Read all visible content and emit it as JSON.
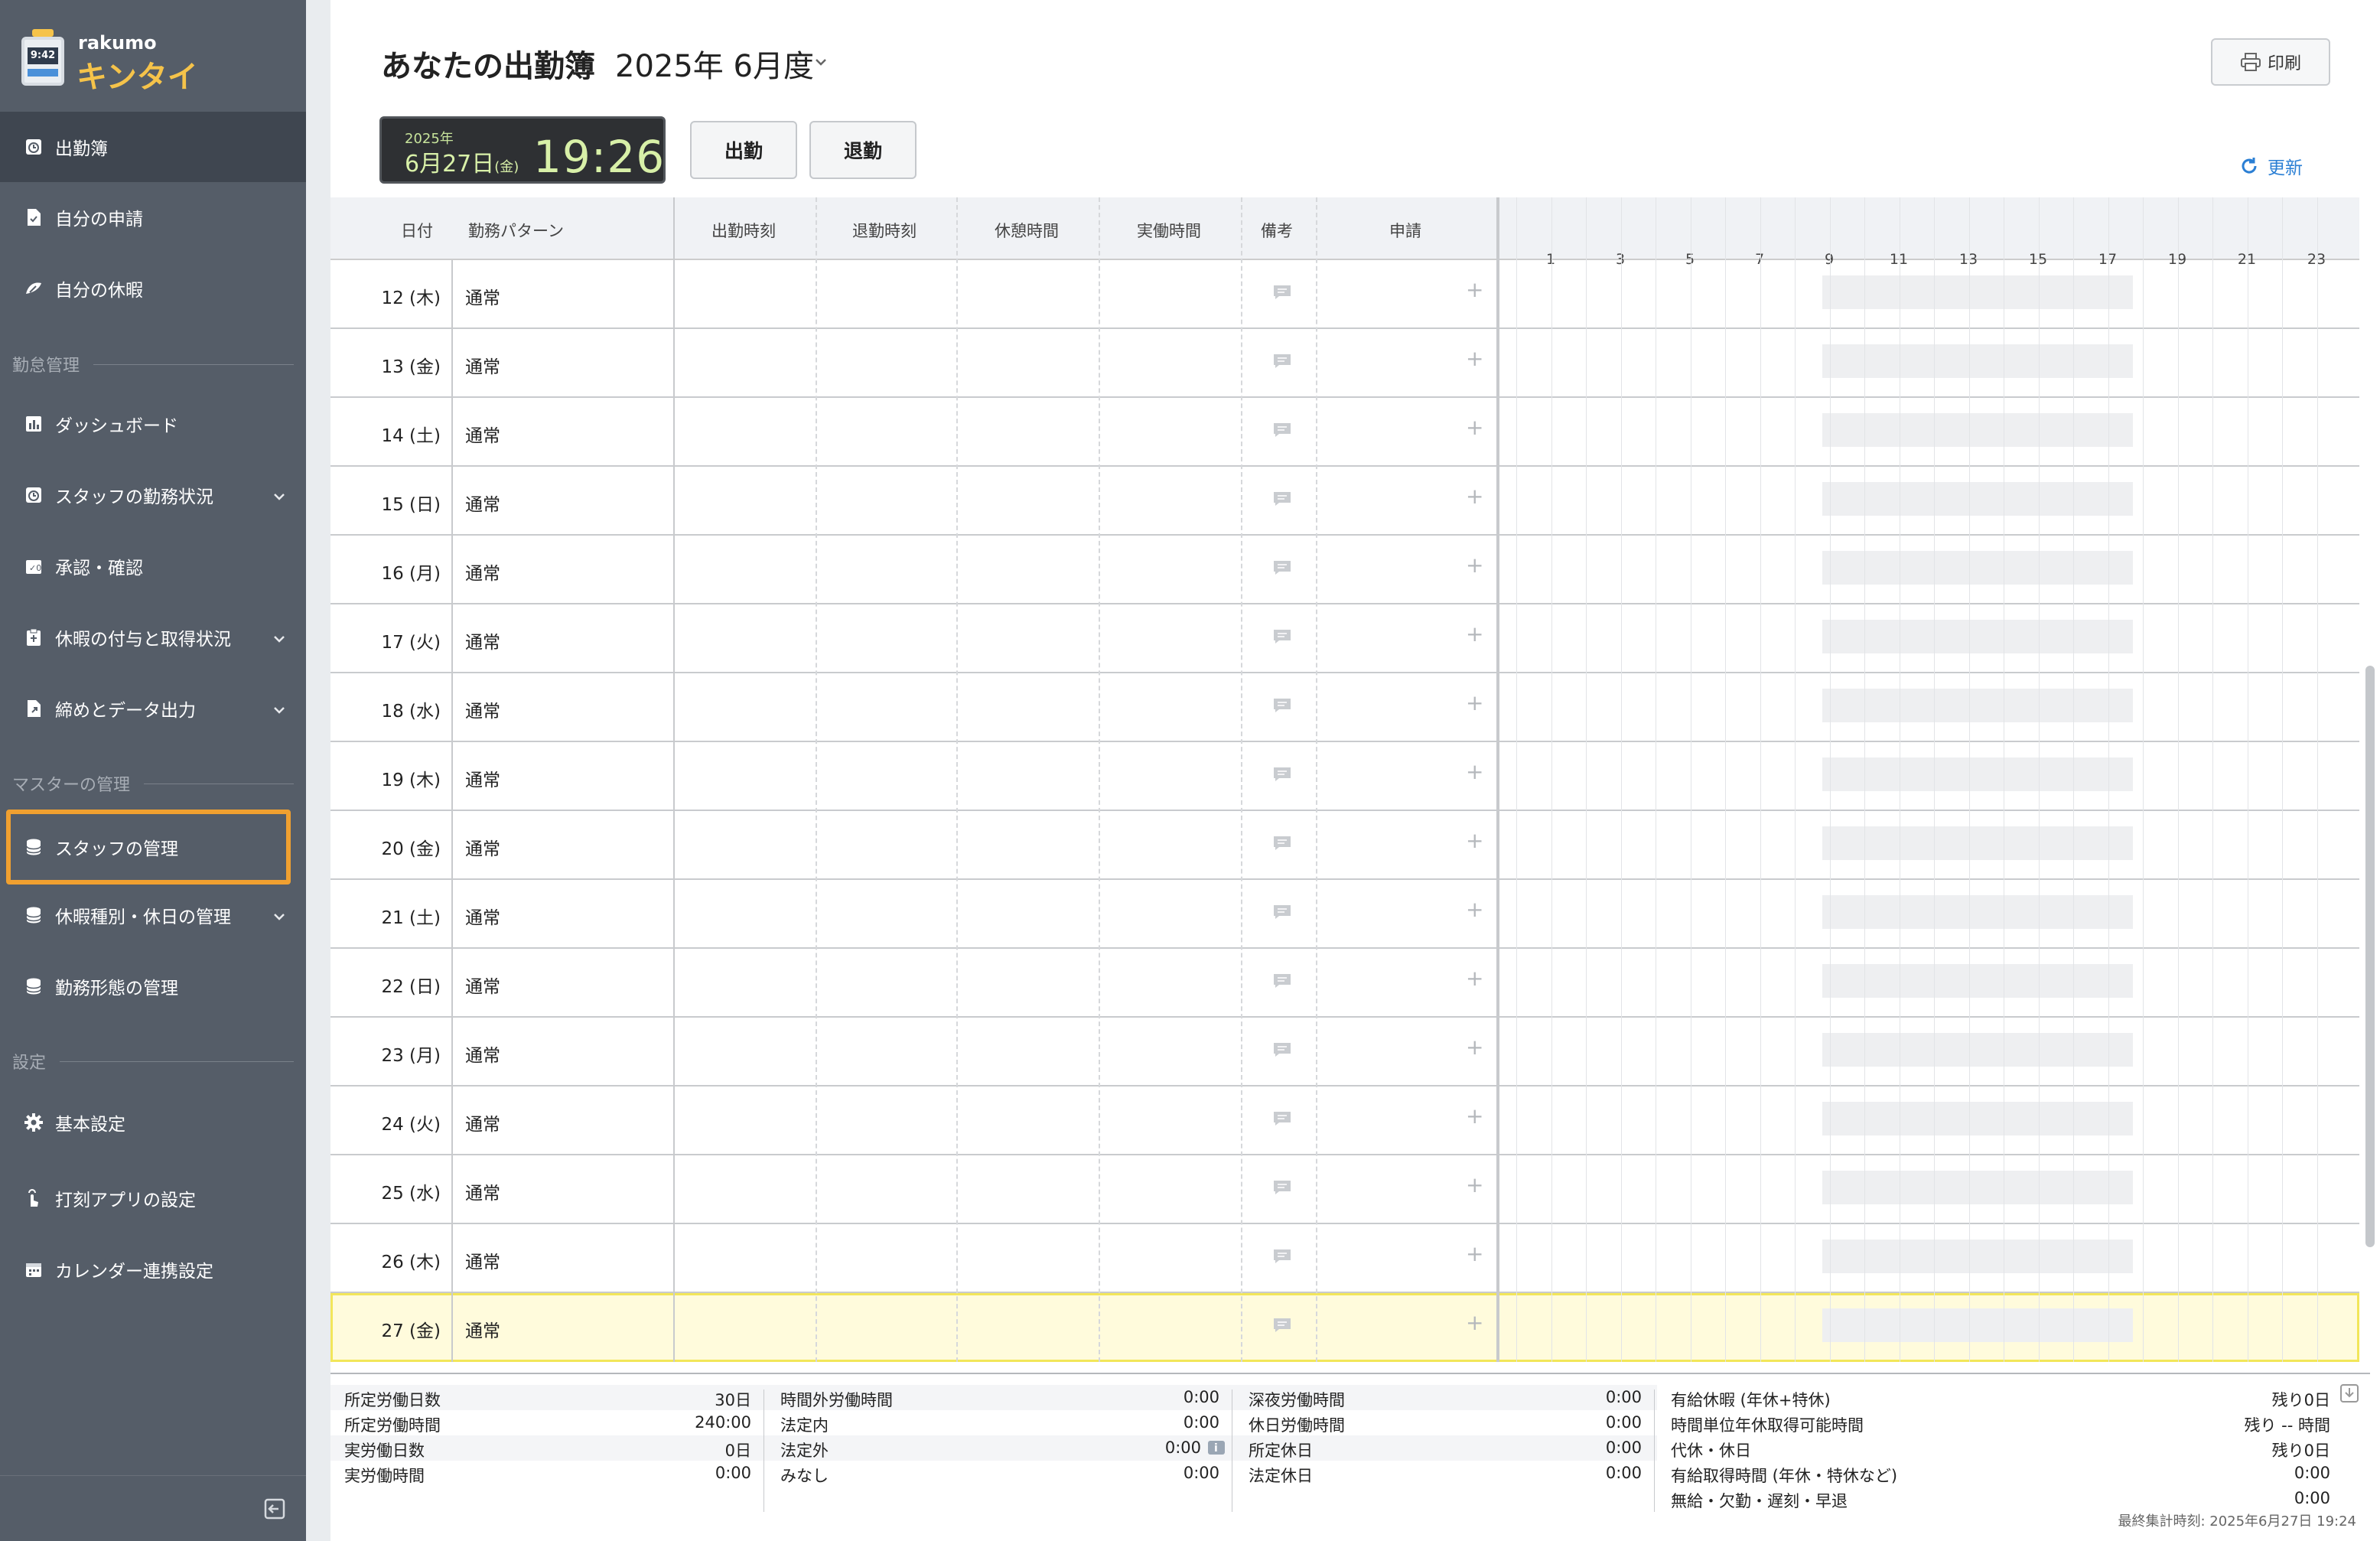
{
  "app": {
    "logo_text_top": "rakumo",
    "logo_text_bottom": "キンタイ",
    "logo_clock": "9:42"
  },
  "sidebar": {
    "items_top": [
      {
        "label": "出勤簿",
        "icon": "clock-icon",
        "active": true
      },
      {
        "label": "自分の申請",
        "icon": "document-icon"
      },
      {
        "label": "自分の休暇",
        "icon": "leave-icon"
      }
    ],
    "section_attendance": "勤怠管理",
    "items_attendance": [
      {
        "label": "ダッシュボード",
        "icon": "chart-icon"
      },
      {
        "label": "スタッフの勤務状況",
        "icon": "clock-icon",
        "expand": true
      },
      {
        "label": "承認・確認",
        "icon": "approve-icon"
      },
      {
        "label": "休暇の付与と取得状況",
        "icon": "clipboard-icon",
        "expand": true
      },
      {
        "label": "締めとデータ出力",
        "icon": "export-icon",
        "expand": true
      }
    ],
    "section_master": "マスターの管理",
    "items_master": [
      {
        "label": "スタッフの管理",
        "icon": "database-icon",
        "highlight": true
      },
      {
        "label": "休暇種別・休日の管理",
        "icon": "database-icon",
        "expand": true
      },
      {
        "label": "勤務形態の管理",
        "icon": "database-icon"
      }
    ],
    "section_settings": "設定",
    "items_settings": [
      {
        "label": "基本設定",
        "icon": "gear-icon"
      },
      {
        "label": "打刻アプリの設定",
        "icon": "tap-icon"
      },
      {
        "label": "カレンダー連携設定",
        "icon": "calendar-icon"
      }
    ]
  },
  "header": {
    "title": "あなたの出勤簿",
    "month": "2025年 6月度",
    "print_label": "印刷",
    "refresh_label": "更新"
  },
  "clock": {
    "year": "2025年",
    "date": "6月27日",
    "weekday": "(金)",
    "time": "19:26"
  },
  "buttons": {
    "clock_in": "出勤",
    "clock_out": "退勤"
  },
  "table": {
    "columns": [
      "日付",
      "勤務パターン",
      "出勤時刻",
      "退勤時刻",
      "休憩時間",
      "実働時間",
      "備考",
      "申請"
    ],
    "hours": [
      "1",
      "3",
      "5",
      "7",
      "9",
      "11",
      "13",
      "15",
      "17",
      "19",
      "21",
      "23"
    ],
    "rows": [
      {
        "date": "12 (木)",
        "pattern": "通常"
      },
      {
        "date": "13 (金)",
        "pattern": "通常"
      },
      {
        "date": "14 (土)",
        "pattern": "通常"
      },
      {
        "date": "15 (日)",
        "pattern": "通常"
      },
      {
        "date": "16 (月)",
        "pattern": "通常"
      },
      {
        "date": "17 (火)",
        "pattern": "通常"
      },
      {
        "date": "18 (水)",
        "pattern": "通常"
      },
      {
        "date": "19 (木)",
        "pattern": "通常"
      },
      {
        "date": "20 (金)",
        "pattern": "通常"
      },
      {
        "date": "21 (土)",
        "pattern": "通常"
      },
      {
        "date": "22 (日)",
        "pattern": "通常"
      },
      {
        "date": "23 (月)",
        "pattern": "通常"
      },
      {
        "date": "24 (火)",
        "pattern": "通常"
      },
      {
        "date": "25 (水)",
        "pattern": "通常"
      },
      {
        "date": "26 (木)",
        "pattern": "通常"
      },
      {
        "date": "27 (金)",
        "pattern": "通常",
        "today": true
      }
    ],
    "plus": "+"
  },
  "summary": {
    "col1": [
      {
        "k": "所定労働日数",
        "v": "30日"
      },
      {
        "k": "所定労働時間",
        "v": "240:00"
      },
      {
        "k": "実労働日数",
        "v": "0日"
      },
      {
        "k": "実労働時間",
        "v": "0:00"
      }
    ],
    "col2": [
      {
        "k": "時間外労働時間",
        "v": "0:00"
      },
      {
        "k": "法定内",
        "v": "0:00"
      },
      {
        "k": "法定外",
        "v": "0:00"
      },
      {
        "k": "みなし",
        "v": "0:00"
      }
    ],
    "col3": [
      {
        "k": "深夜労働時間",
        "v": "0:00"
      },
      {
        "k": "休日労働時間",
        "v": "0:00"
      },
      {
        "k": "所定休日",
        "v": "0:00"
      },
      {
        "k": "法定休日",
        "v": "0:00"
      }
    ],
    "col4": [
      {
        "k": "有給休暇 (年休+特休)",
        "v": "残り0日"
      },
      {
        "k": "時間単位年休取得可能時間",
        "v": "残り -- 時間"
      },
      {
        "k": "代休・休日",
        "v": "残り0日"
      },
      {
        "k": "有給取得時間 (年休・特休など)",
        "v": "0:00"
      },
      {
        "k": "無給・欠勤・遅刻・早退",
        "v": "0:00"
      }
    ],
    "last_calc": "最終集計時刻: 2025年6月27日 19:24"
  },
  "colors": {
    "sidebar_bg": "#555d68",
    "accent_yellow": "#f5c34a",
    "highlight_orange": "#f0a030",
    "link_blue": "#2b7fd4",
    "today_row": "#fffbdc"
  }
}
